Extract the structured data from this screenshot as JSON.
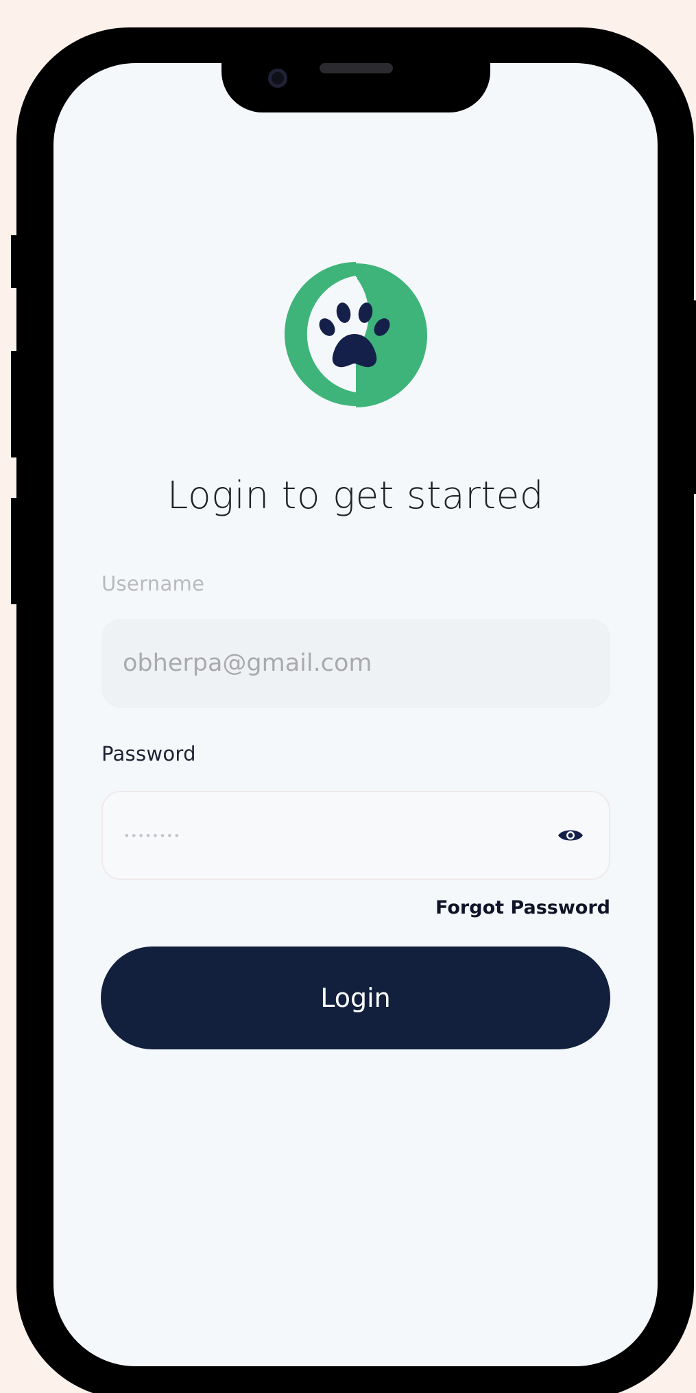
{
  "login": {
    "title": "Login to get started",
    "username": {
      "label": "Username",
      "value": "obherpa@gmail.com"
    },
    "password": {
      "label": "Password",
      "masked_value": "••••••••",
      "toggle_icon": "eye-icon"
    },
    "forgot_password_label": "Forgot Password",
    "submit_label": "Login"
  },
  "logo": {
    "icon": "paw-icon",
    "ring_color": "#3fb47a",
    "paw_color": "#14204a"
  },
  "colors": {
    "background": "#fdf1ec",
    "screen": "#f5f8fa",
    "primary_button": "#12203e"
  }
}
